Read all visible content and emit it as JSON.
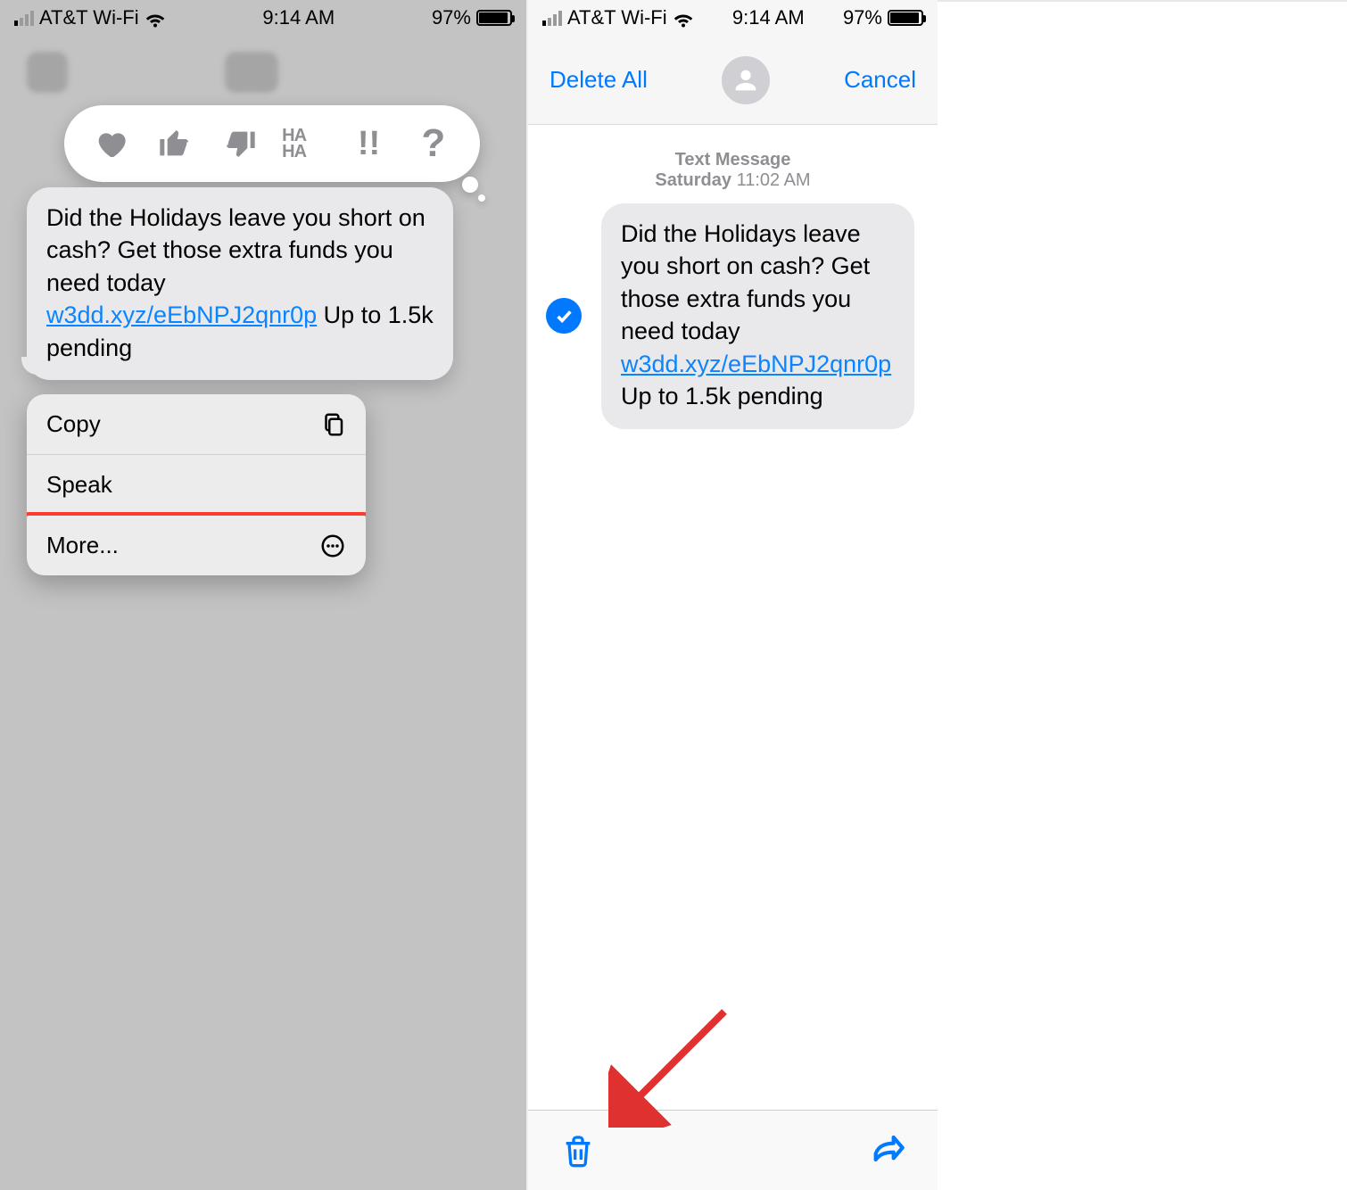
{
  "status": {
    "carrier": "AT&T Wi-Fi",
    "time": "9:14 AM",
    "battery_pct": "97%"
  },
  "message": {
    "text_before": "Did the Holidays leave you short on cash? Get those extra funds you need today ",
    "link": "w3dd.xyz/eEbNPJ2qnr0p",
    "text_after": " Up to 1.5k pending"
  },
  "left": {
    "tapbacks": {
      "heart": "heart-icon",
      "thumbs_up": "thumbs-up-icon",
      "thumbs_down": "thumbs-down-icon",
      "haha": "HA HA",
      "emphasis": "!!",
      "question": "?"
    },
    "menu": {
      "copy": "Copy",
      "speak": "Speak",
      "more": "More..."
    }
  },
  "right": {
    "nav": {
      "delete_all": "Delete All",
      "cancel": "Cancel"
    },
    "meta": {
      "label": "Text Message",
      "day": "Saturday",
      "time": "11:02 AM"
    }
  }
}
